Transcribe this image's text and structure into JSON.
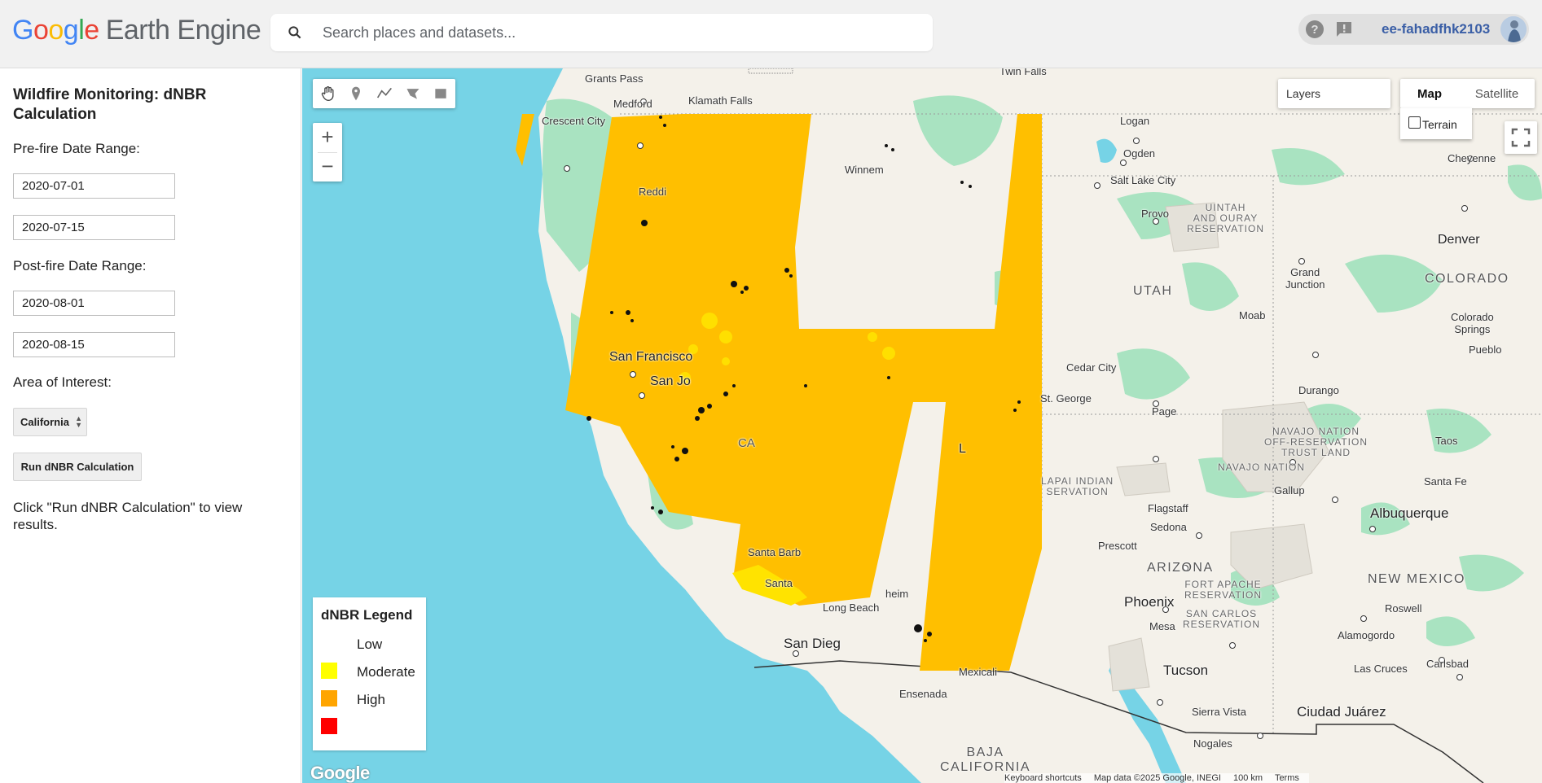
{
  "header": {
    "logo_google": "Google",
    "logo_product": "Earth Engine",
    "search_placeholder": "Search places and datasets...",
    "username": "ee-fahadfhk2103",
    "icons": [
      "search-icon",
      "help-icon",
      "feedback-icon",
      "avatar"
    ]
  },
  "panel": {
    "title": "Wildfire Monitoring: dNBR Calculation",
    "prefire_label": "Pre-fire Date Range:",
    "prefire_start": "2020-07-01",
    "prefire_end": "2020-07-15",
    "postfire_label": "Post-fire Date Range:",
    "postfire_start": "2020-08-01",
    "postfire_end": "2020-08-15",
    "aoi_label": "Area of Interest:",
    "aoi_value": "California",
    "run_button": "Run dNBR Calculation",
    "result_text": "Click \"Run dNBR Calculation\" to view results."
  },
  "map": {
    "layers_label": "Layers",
    "map_type_map": "Map",
    "map_type_satellite": "Satellite",
    "terrain_label": "Terrain",
    "zoom_in": "+",
    "zoom_out": "−",
    "watermark": "Google",
    "footer": {
      "shortcuts": "Keyboard shortcuts",
      "attribution": "Map data ©2025 Google, INEGI",
      "scale": "100 km",
      "terms": "Terms"
    },
    "labels": {
      "grants_pass": "Grants Pass",
      "medford": "Medford",
      "klamath_falls": "Klamath Falls",
      "crescent_city": "Crescent City",
      "redding": "Reddi",
      "winnemucca": "Winnem",
      "twin_falls": "Twin Falls",
      "logan": "Logan",
      "ogden": "Ogden",
      "salt_lake_city": "Salt Lake City",
      "provo": "Provo",
      "cheyenne": "Cheyenne",
      "denver": "Denver",
      "uintah": "UINTAH\nAND OURAY\nRESERVATION",
      "utah": "UTAH",
      "colorado": "COLORADO",
      "grand_junction": "Grand\nJunction",
      "moab": "Moab",
      "colorado_springs": "Colorado\nSprings",
      "pueblo": "Pueblo",
      "san_francisco": "San Francisco",
      "san_jose": "San Jo",
      "ca": "CA",
      "cedar_city": "Cedar City",
      "st_george": "St. George",
      "page": "Page",
      "durango": "Durango",
      "navajo_off": "NAVAJO NATION\nOFF-RESERVATION\nTRUST LAND",
      "navajo": "NAVAJO NATION",
      "taos": "Taos",
      "hualapai": "LAPAI INDIAN\nSERVATION",
      "las_vegas": "L",
      "flagstaff": "Flagstaff",
      "sedona": "Sedona",
      "gallup": "Gallup",
      "santa_fe": "Santa Fe",
      "albuquerque": "Albuquerque",
      "santa_barbara": "Santa Barb",
      "santa": "Santa",
      "anaheim": "heim",
      "long_beach": "Long Beach",
      "prescott": "Prescott",
      "arizona": "ARIZONA",
      "new_mexico": "NEW MEXICO",
      "fort_apache": "FORT APACHE\nRESERVATION",
      "san_carlos": "SAN CARLOS\nRESERVATION",
      "phoenix": "Phoenix",
      "mesa": "Mesa",
      "roswell": "Roswell",
      "alamogordo": "Alamogordo",
      "san_diego": "San Dieg",
      "mexicali": "Mexicali",
      "tucson": "Tucson",
      "las_cruces": "Las Cruces",
      "carlsbad": "Carlsbad",
      "ensenada": "Ensenada",
      "sierra_vista": "Sierra Vista",
      "ciudad_juarez": "Ciudad Juárez",
      "nogales": "Nogales",
      "baja": "BAJA\nCALIFORNIA"
    }
  },
  "legend": {
    "title": "dNBR Legend",
    "items": [
      {
        "label": "Low",
        "color": "#ffffff"
      },
      {
        "label": "Moderate",
        "color": "#ffff00"
      },
      {
        "label": "High",
        "color": "#ffa500"
      },
      {
        "label": "",
        "color": "#ff0000"
      }
    ]
  },
  "colors": {
    "ocean": "#76d3e6",
    "land": "#f4f1ea",
    "vegetation": "#a9e3c1",
    "dnbr_fill": "#ffbf00"
  }
}
